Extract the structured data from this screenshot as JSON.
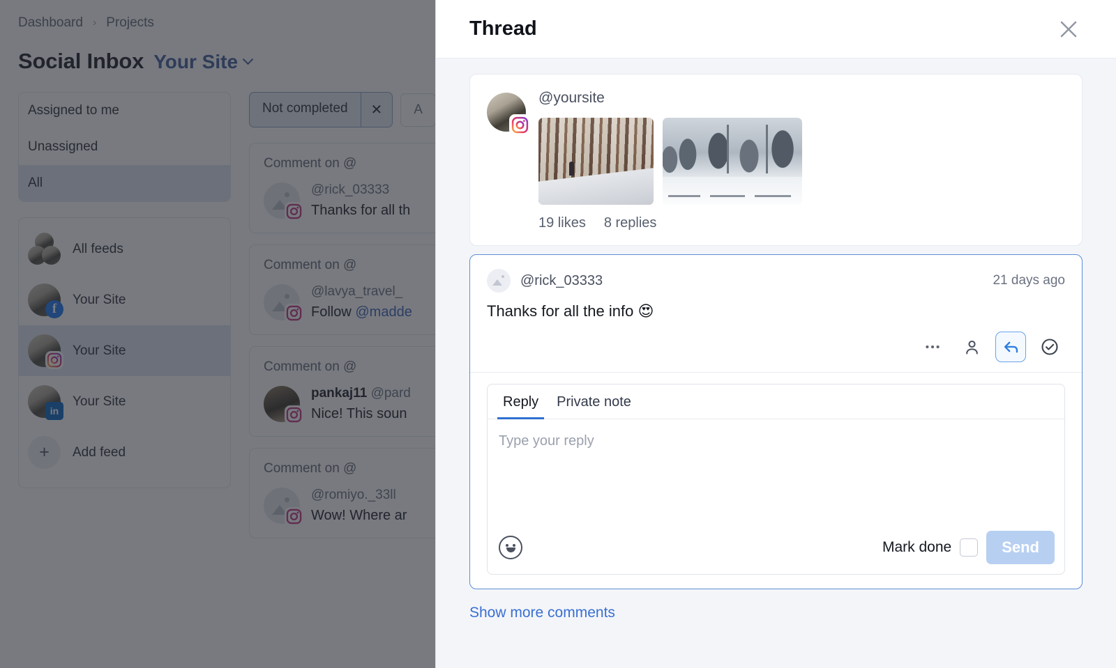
{
  "background": {
    "breadcrumb": {
      "items": [
        "Dashboard",
        "Projects"
      ],
      "separator": "›"
    },
    "page_title": "Social Inbox",
    "site_selector": "Your Site",
    "assignment_filters": [
      {
        "label": "Assigned to me",
        "active": false
      },
      {
        "label": "Unassigned",
        "active": false
      },
      {
        "label": "All",
        "active": true
      }
    ],
    "feeds": [
      {
        "label": "All feeds",
        "network": "all",
        "active": false
      },
      {
        "label": "Your Site",
        "network": "facebook",
        "active": false
      },
      {
        "label": "Your Site",
        "network": "instagram",
        "active": true
      },
      {
        "label": "Your Site",
        "network": "linkedin",
        "active": false
      },
      {
        "label": "Add feed",
        "network": "add",
        "active": false
      }
    ],
    "filter_chips": [
      {
        "label": "Not completed",
        "removable": true,
        "active": true
      },
      {
        "label": "A",
        "removable": false,
        "active": false
      }
    ],
    "comment_cards": [
      {
        "header": "Comment on @",
        "handle": "@rick_03333",
        "handle_bold": "",
        "text": "Thanks for all th",
        "avatar": "placeholder",
        "network": "instagram"
      },
      {
        "header": "Comment on @",
        "handle": "@lavya_travel_",
        "handle_bold": "",
        "text": "Follow ",
        "mention": "@madde",
        "avatar": "placeholder",
        "network": "instagram"
      },
      {
        "header": "Comment on @",
        "handle": "@pard",
        "handle_bold": "pankaj11",
        "text": "Nice! This soun",
        "avatar": "photo",
        "network": "instagram"
      },
      {
        "header": "Comment on @",
        "handle": "@romiyo._33ll",
        "handle_bold": "",
        "text": "Wow! Where ar",
        "avatar": "placeholder",
        "network": "instagram"
      }
    ]
  },
  "panel": {
    "title": "Thread",
    "close_icon": "close-icon",
    "post": {
      "handle": "@yoursite",
      "network_badge": "instagram-icon",
      "images": [
        {
          "alt": "snowy forest path with person walking"
        },
        {
          "alt": "snow covered pine trees and park benches"
        }
      ],
      "likes": "19 likes",
      "replies": "8 replies"
    },
    "thread_comment": {
      "handle": "@rick_03333",
      "time": "21 days ago",
      "text": "Thanks for all the info 😍",
      "actions": [
        {
          "name": "more-options-icon",
          "label": "…",
          "selected": false
        },
        {
          "name": "assign-user-icon",
          "label": "assign",
          "selected": false
        },
        {
          "name": "reply-icon",
          "label": "reply",
          "selected": true
        },
        {
          "name": "mark-done-icon",
          "label": "done",
          "selected": false
        }
      ]
    },
    "composer": {
      "tabs": [
        {
          "label": "Reply",
          "active": true
        },
        {
          "label": "Private note",
          "active": false
        }
      ],
      "placeholder": "Type your reply",
      "value": "",
      "emoji_icon": "emoji-icon",
      "mark_done_label": "Mark done",
      "mark_done_checked": false,
      "send_label": "Send",
      "send_enabled": false
    },
    "show_more_label": "Show more comments"
  },
  "colors": {
    "accent": "#3a6fd0",
    "panel_bg": "#f3f5f9",
    "card_border_selected": "#5b8dd6",
    "send_disabled": "#b7d0f2",
    "overlay": "rgba(37,40,48,0.62)"
  }
}
